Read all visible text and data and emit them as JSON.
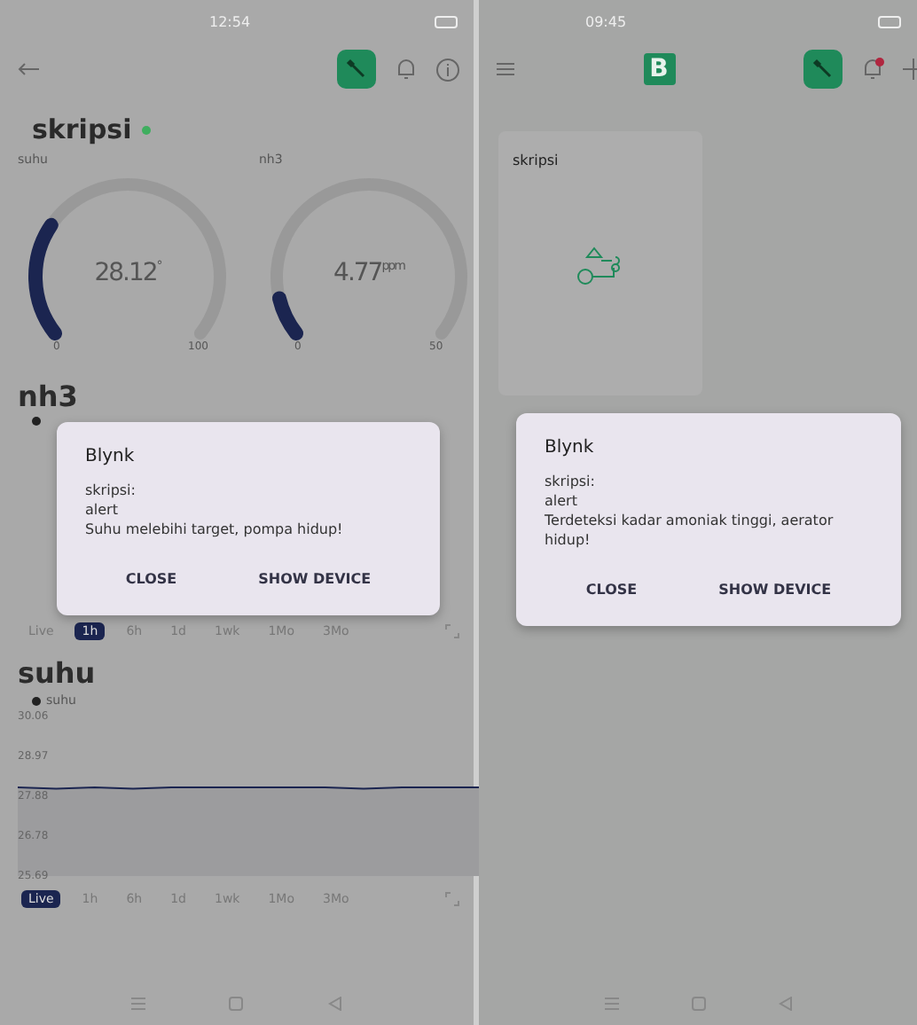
{
  "left_screen": {
    "status_bar": {
      "time": "12:54"
    },
    "top_bar": {
      "notification": false
    },
    "device": {
      "name": "skripsi",
      "online": true
    },
    "gauges": [
      {
        "label": "suhu",
        "value": "28.12",
        "unit": "°",
        "min": "0",
        "max": "100"
      },
      {
        "label": "nh3",
        "value": "4.77",
        "unit": "ppm",
        "min": "0",
        "max": "50"
      }
    ],
    "nh3_chart": {
      "title": "nh3",
      "ranges": [
        {
          "label": "Live",
          "selected": false
        },
        {
          "label": "1h",
          "selected": true
        },
        {
          "label": "6h",
          "selected": false
        },
        {
          "label": "1d",
          "selected": false
        },
        {
          "label": "1wk",
          "selected": false
        },
        {
          "label": "1Mo",
          "selected": false
        },
        {
          "label": "3Mo",
          "selected": false
        }
      ]
    },
    "suhu_chart": {
      "title": "suhu",
      "chart_data": {
        "type": "area",
        "series": [
          {
            "name": "suhu",
            "color": "#1b2550",
            "values": [
              28.12,
              28.08,
              28.12,
              28.08,
              28.12,
              28.12,
              28.12,
              28.12,
              28.12,
              28.08,
              28.12,
              28.12,
              28.12
            ]
          }
        ],
        "ylim": [
          25.69,
          30.06
        ],
        "yticks": [
          25.69,
          26.78,
          27.88,
          28.97,
          30.06
        ]
      },
      "ranges": [
        {
          "label": "Live",
          "selected": true
        },
        {
          "label": "1h",
          "selected": false
        },
        {
          "label": "6h",
          "selected": false
        },
        {
          "label": "1d",
          "selected": false
        },
        {
          "label": "1wk",
          "selected": false
        },
        {
          "label": "1Mo",
          "selected": false
        },
        {
          "label": "3Mo",
          "selected": false
        }
      ]
    },
    "dialog": {
      "title": "Blynk",
      "lines": [
        "skripsi:",
        "alert",
        "Suhu melebihi target, pompa hidup!"
      ],
      "buttons": [
        "CLOSE",
        "SHOW DEVICE"
      ]
    }
  },
  "right_screen": {
    "status_bar": {
      "time": "09:45"
    },
    "top_bar": {
      "logo": "B",
      "notification": true
    },
    "devices": [
      {
        "name": "skripsi"
      }
    ],
    "dialog": {
      "title": "Blynk",
      "lines": [
        "skripsi:",
        "alert",
        "Terdeteksi kadar amoniak tinggi, aerator hidup!"
      ],
      "buttons": [
        "CLOSE",
        "SHOW DEVICE"
      ]
    }
  }
}
